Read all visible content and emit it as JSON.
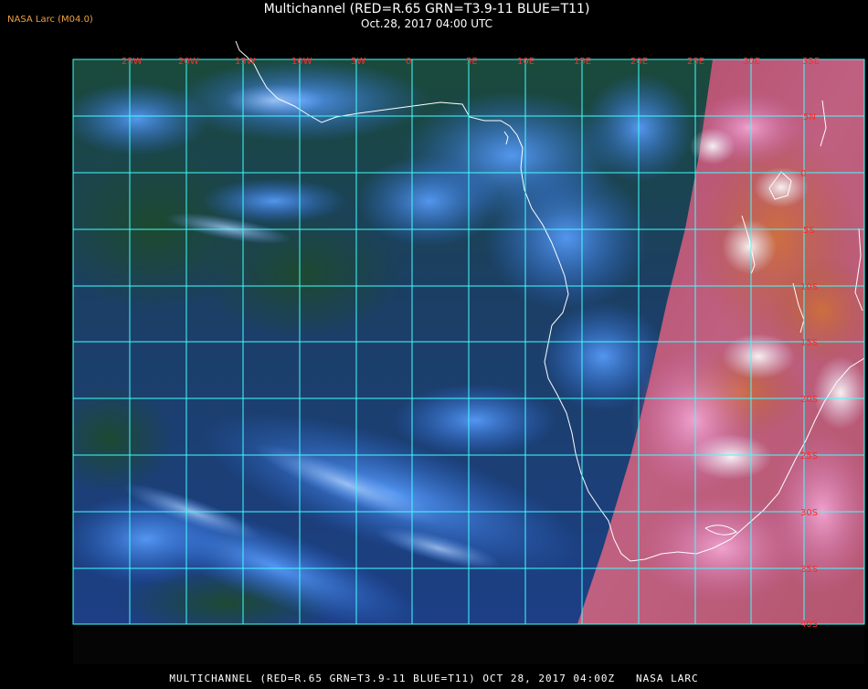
{
  "header": {
    "agency": "NASA Larc (M04.0)",
    "title": "Multichannel (RED=R.65 GRN=T3.9-11 BLUE=T11)",
    "datetime": "Oct.28, 2017 04:00 UTC"
  },
  "map": {
    "lon_labels": [
      "25W",
      "20W",
      "15W",
      "10W",
      "5W",
      "0",
      "5E",
      "10E",
      "15E",
      "20E",
      "25E",
      "30E",
      "35E"
    ],
    "lat_labels": [
      "5N",
      "0",
      "5S",
      "10S",
      "15S",
      "20S",
      "25S",
      "30S",
      "35S",
      "40S"
    ],
    "colors": {
      "ocean": "#1e3a8a",
      "grid": "#40ffff",
      "coast": "#ffffff",
      "label": "#ff2a2a"
    }
  },
  "footer": {
    "caption": "MULTICHANNEL (RED=R.65 GRN=T3.9-11 BLUE=T11) OCT 28, 2017 04:00Z   NASA LARC"
  }
}
